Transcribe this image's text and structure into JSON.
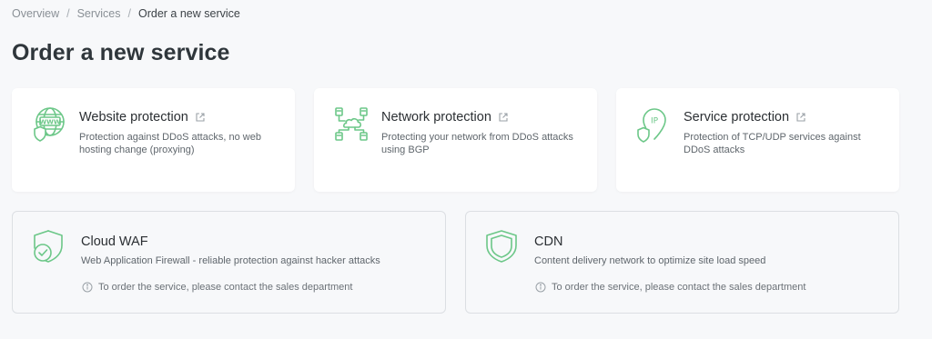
{
  "breadcrumb": {
    "items": [
      "Overview",
      "Services"
    ],
    "separator": "/",
    "current": "Order a new service"
  },
  "page": {
    "title": "Order a new service"
  },
  "colors": {
    "accent": "#6cc788",
    "background": "#f7f8fa",
    "card": "#ffffff"
  },
  "services": [
    {
      "title": "Website protection",
      "description": "Protection against DDoS attacks, no web hosting change (proxying)",
      "icon": "globe-shield-icon"
    },
    {
      "title": "Network protection",
      "description": "Protecting your network from DDoS attacks using BGP",
      "icon": "network-cloud-icon"
    },
    {
      "title": "Service protection",
      "description": "Protection of TCP/UDP services against DDoS attacks",
      "icon": "ip-shield-icon"
    }
  ],
  "contact_services": [
    {
      "title": "Cloud WAF",
      "description": "Web Application Firewall - reliable protection against hacker attacks",
      "note": "To order the service, please contact the sales department",
      "icon": "shield-check-icon"
    },
    {
      "title": "CDN",
      "description": "Content delivery network to optimize site load speed",
      "note": "To order the service, please contact the sales department",
      "icon": "shield-icon"
    }
  ]
}
